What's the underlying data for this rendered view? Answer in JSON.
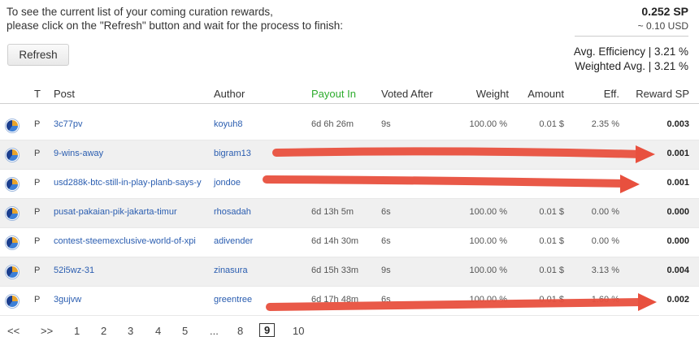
{
  "intro": {
    "line1": "To see the current list of your coming curation rewards,",
    "line2": "please click on the \"Refresh\" button and wait for the process to finish:"
  },
  "totals": {
    "sp": "0.252 SP",
    "usd": "~ 0.10 USD"
  },
  "refresh_label": "Refresh",
  "efficiency": {
    "avg": "Avg. Efficiency | 3.21 %",
    "weighted": "Weighted Avg. | 3.21 %"
  },
  "columns": {
    "type": "T",
    "post": "Post",
    "author": "Author",
    "payout": "Payout In",
    "voted": "Voted After",
    "weight": "Weight",
    "amount": "Amount",
    "eff": "Eff.",
    "reward": "Reward SP"
  },
  "rows": [
    {
      "type": "P",
      "post": "3c77pv",
      "author": "koyuh8",
      "payout": "6d 6h 26m",
      "voted": "9s",
      "weight": "100.00 %",
      "amount": "0.01 $",
      "eff": "2.35 %",
      "reward": "0.003"
    },
    {
      "type": "P",
      "post": "9-wins-away",
      "author": "bigram13",
      "payout": "",
      "voted": "",
      "weight": "",
      "amount": "",
      "eff": "",
      "reward": "0.001"
    },
    {
      "type": "P",
      "post": "usd288k-btc-still-in-play-planb-says-y",
      "author": "jondoe",
      "payout": "",
      "voted": "",
      "weight": "",
      "amount": "",
      "eff": "",
      "reward": "0.001"
    },
    {
      "type": "P",
      "post": "pusat-pakaian-pik-jakarta-timur",
      "author": "rhosadah",
      "payout": "6d 13h 5m",
      "voted": "6s",
      "weight": "100.00 %",
      "amount": "0.01 $",
      "eff": "0.00 %",
      "reward": "0.000"
    },
    {
      "type": "P",
      "post": "contest-steemexclusive-world-of-xpi",
      "author": "adivender",
      "payout": "6d 14h 30m",
      "voted": "6s",
      "weight": "100.00 %",
      "amount": "0.01 $",
      "eff": "0.00 %",
      "reward": "0.000"
    },
    {
      "type": "P",
      "post": "52i5wz-31",
      "author": "zinasura",
      "payout": "6d 15h 33m",
      "voted": "9s",
      "weight": "100.00 %",
      "amount": "0.01 $",
      "eff": "3.13 %",
      "reward": "0.004"
    },
    {
      "type": "P",
      "post": "3gujvw",
      "author": "greentree",
      "payout": "6d 17h 48m",
      "voted": "6s",
      "weight": "100.00 %",
      "amount": "0.01 $",
      "eff": "1.60 %",
      "reward": "0.002"
    }
  ],
  "pager": [
    "<<",
    ">>",
    "1",
    "2",
    "3",
    "4",
    "5",
    "...",
    "8",
    "9",
    "10"
  ],
  "annotation_color": "#e8503e"
}
